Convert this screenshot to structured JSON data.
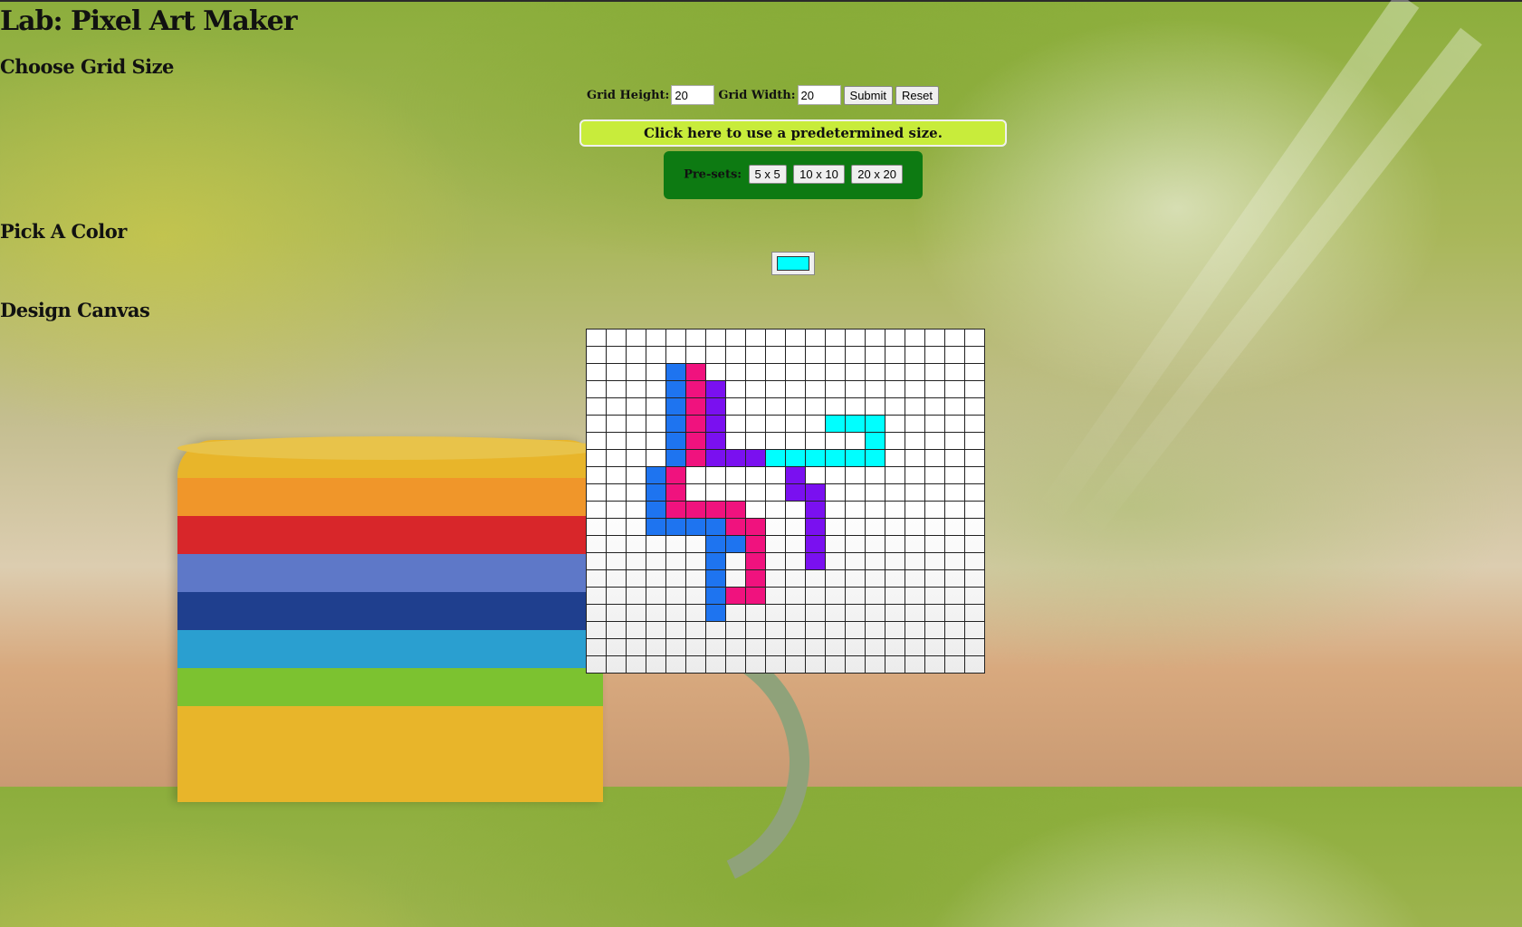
{
  "header": {
    "title": "Lab: Pixel Art Maker"
  },
  "grid_size": {
    "heading": "Choose Grid Size",
    "height_label": "Grid Height:",
    "height_value": "20",
    "width_label": "Grid Width:",
    "width_value": "20",
    "submit_label": "Submit",
    "reset_label": "Reset"
  },
  "predetermined": {
    "label": "Click here to use a predetermined size."
  },
  "presets": {
    "label": "Pre-sets:",
    "options": [
      "5 x 5",
      "10 x 10",
      "20 x 20"
    ]
  },
  "color": {
    "heading": "Pick A Color",
    "value": "#00ffff"
  },
  "canvas": {
    "heading": "Design Canvas",
    "rows": 20,
    "cols": 20,
    "palette": {
      "B": "#1e74f0",
      "P": "#f0127e",
      "V": "#7a10f0",
      "C": "#00ffff"
    },
    "cells": [
      "....................",
      "....................",
      "....BP..............",
      "....BPV.............",
      "....BPV.............",
      "....BPV.....CCC.....",
      "....BPV.......C.....",
      "....BPVVVCCCCCC.....",
      "...BP.....V.........",
      "...BP.....VV........",
      "...BPPPP...V........",
      "...BBBBPP..V........",
      "......BBP..V........",
      "......B.P..V........",
      "......B.P...........",
      "......BPP...........",
      "......B.............",
      "....................",
      "....................",
      "...................."
    ]
  }
}
